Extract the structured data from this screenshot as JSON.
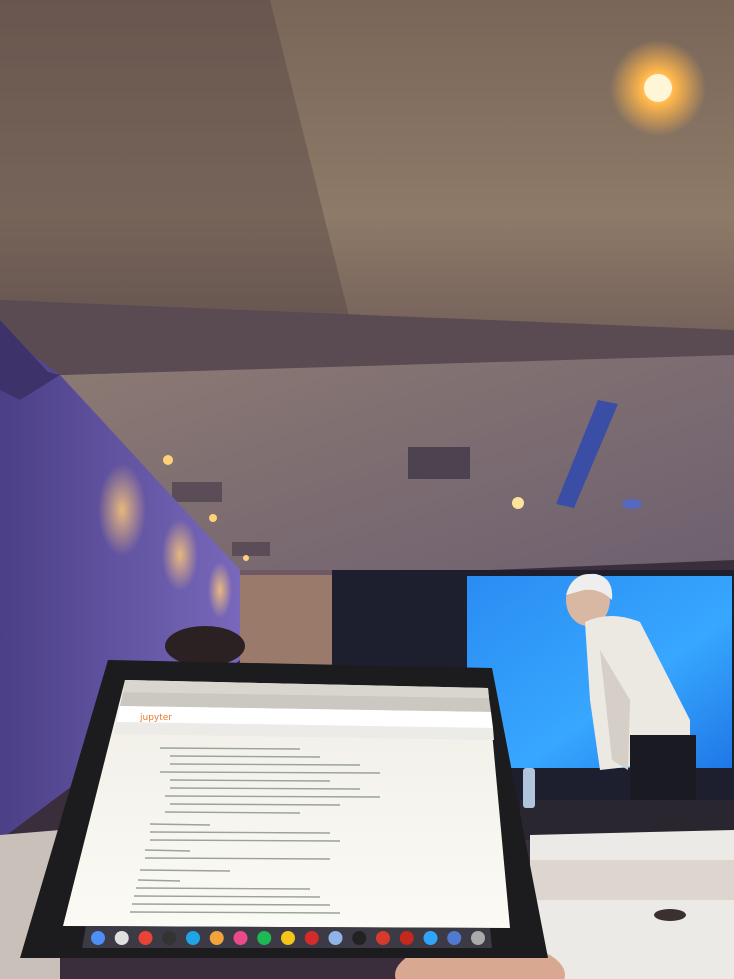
{
  "scene": {
    "kind": "photo",
    "colors": {
      "ceiling": "#8b7766",
      "ceiling_dark": "#3f3536",
      "wall_purple": "#6c5cb0",
      "projection": "#1f8ff5",
      "laptop_screen": "#f4f1ea",
      "laptop_body": "#1c1c1f",
      "warm_light": "#ffb64b",
      "table_white": "#eceae6",
      "shirt": "#ece8e2"
    }
  },
  "laptop": {
    "app": "jupyter",
    "dock_apps": [
      "finder-icon",
      "launchpad-icon",
      "chrome-icon",
      "github-icon",
      "skype-icon",
      "sublime-icon",
      "itunes-icon",
      "spotify-icon",
      "chrome-canary-icon",
      "filezilla-icon",
      "preview-icon",
      "terminal-icon",
      "flash-icon",
      "acrobat-icon",
      "photoshop-icon",
      "lightroom-icon",
      "trash-icon"
    ]
  }
}
